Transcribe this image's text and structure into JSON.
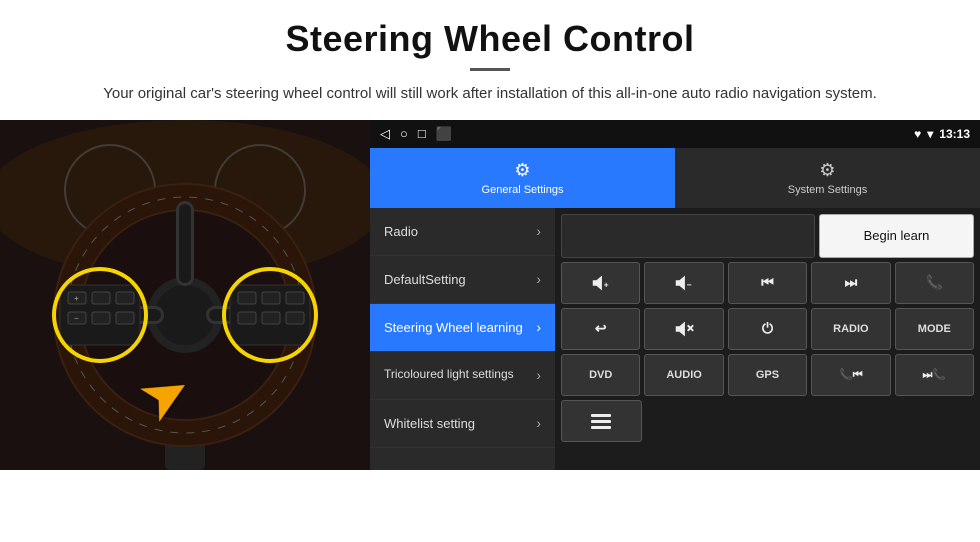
{
  "header": {
    "title": "Steering Wheel Control",
    "divider": true,
    "subtitle": "Your original car's steering wheel control will still work after installation of this all-in-one auto radio navigation system."
  },
  "status_bar": {
    "icons": [
      "◁",
      "○",
      "□",
      "⬛"
    ],
    "right_icons": [
      "♥",
      "▾"
    ],
    "time": "13:13"
  },
  "tabs": [
    {
      "id": "general",
      "label": "General Settings",
      "icon": "⚙",
      "active": true
    },
    {
      "id": "system",
      "label": "System Settings",
      "icon": "⚙",
      "active": false
    }
  ],
  "menu": [
    {
      "id": "radio",
      "label": "Radio",
      "active": false
    },
    {
      "id": "default",
      "label": "DefaultSetting",
      "active": false
    },
    {
      "id": "steering",
      "label": "Steering Wheel learning",
      "active": true
    },
    {
      "id": "tricoloured",
      "label": "Tricoloured light settings",
      "active": false
    },
    {
      "id": "whitelist",
      "label": "Whitelist setting",
      "active": false
    }
  ],
  "controls": {
    "begin_learn_label": "Begin learn",
    "buttons_row1": [
      "🔊+",
      "🔊−",
      "⏮",
      "⏭",
      "📞"
    ],
    "buttons_row2": [
      "↩",
      "🔊✕",
      "⏻",
      "RADIO",
      "MODE"
    ],
    "buttons_row3": [
      "DVD",
      "AUDIO",
      "GPS",
      "📞⏮",
      "⏭📞"
    ],
    "buttons_row4": [
      "≡"
    ]
  },
  "colors": {
    "active_blue": "#2979ff",
    "dark_bg": "#1c1c1c",
    "menu_bg": "#2a2a2a",
    "btn_bg": "#333333",
    "status_bg": "#111111"
  }
}
